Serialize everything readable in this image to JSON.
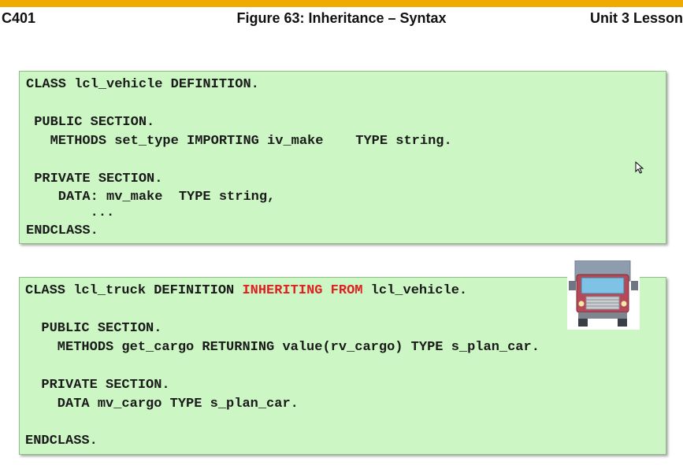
{
  "header": {
    "left": "C401",
    "title": "Figure 63: Inheritance – Syntax",
    "right": "Unit 3 Lesson"
  },
  "box1": {
    "lines": [
      "CLASS lcl_vehicle DEFINITION.",
      " PUBLIC SECTION.",
      "   METHODS set_type IMPORTING iv_make    TYPE string.",
      " PRIVATE SECTION.",
      "    DATA: mv_make  TYPE string,",
      "        ...",
      "ENDCLASS."
    ]
  },
  "box2": {
    "line1_pre": "CLASS lcl_truck DEFINITION ",
    "line1_kw": "INHERITING FROM",
    "line1_post": " lcl_vehicle.",
    "lines": [
      "  PUBLIC SECTION.",
      "    METHODS get_cargo RETURNING value(rv_cargo) TYPE s_plan_car.",
      "  PRIVATE SECTION.",
      "    DATA mv_cargo TYPE s_plan_car.",
      "ENDCLASS."
    ]
  },
  "icons": {
    "truck": "truck-icon",
    "cursor": "mouse-pointer-icon"
  },
  "colors": {
    "accent_bar": "#f0ab00",
    "code_background": "#ccf6c4",
    "keyword_highlight": "#e02020"
  }
}
